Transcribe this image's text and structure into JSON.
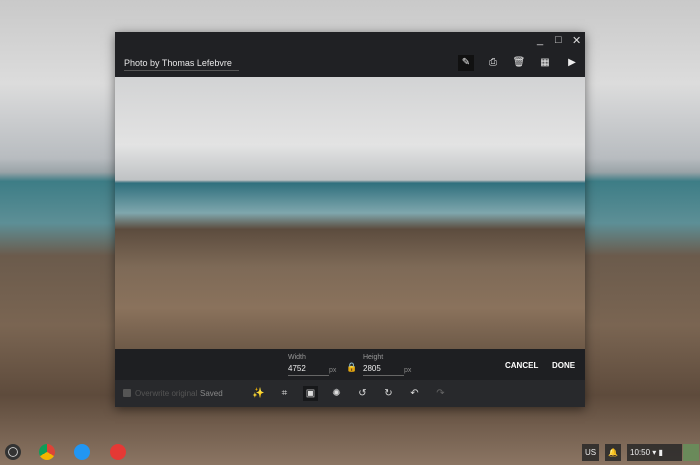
{
  "window": {
    "title": "Photo by Thomas Lefebvre"
  },
  "resize": {
    "width_label": "Width",
    "width_value": "4752",
    "height_label": "Height",
    "height_value": "2805",
    "unit": "px",
    "cancel": "CANCEL",
    "done": "DONE"
  },
  "bottom": {
    "overwrite_label": "Overwrite original",
    "status": "Saved"
  },
  "tray": {
    "ime": "US",
    "time": "10:50"
  }
}
